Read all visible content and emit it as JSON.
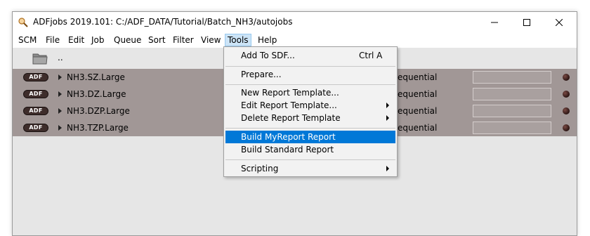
{
  "window": {
    "title": "ADFjobs 2019.101: C:/ADF_DATA/Tutorial/Batch_NH3/autojobs"
  },
  "menubar": {
    "items": [
      "SCM",
      "File",
      "Edit",
      "Job",
      "Queue",
      "Sort",
      "Filter",
      "View",
      "Tools",
      "Help"
    ],
    "active": "Tools"
  },
  "toolbar": {
    "parent_dir": ".."
  },
  "jobs": [
    {
      "badge": "ADF",
      "name": "NH3.SZ.Large",
      "mode": "equential"
    },
    {
      "badge": "ADF",
      "name": "NH3.DZ.Large",
      "mode": "equential"
    },
    {
      "badge": "ADF",
      "name": "NH3.DZP.Large",
      "mode": "equential"
    },
    {
      "badge": "ADF",
      "name": "NH3.TZP.Large",
      "mode": "equential"
    }
  ],
  "tools_menu": {
    "add_to_sdf": {
      "label": "Add To SDF...",
      "shortcut": "Ctrl A"
    },
    "prepare": {
      "label": "Prepare..."
    },
    "new_report_template": {
      "label": "New Report Template..."
    },
    "edit_report_template": {
      "label": "Edit Report Template..."
    },
    "delete_report_template": {
      "label": "Delete Report Template"
    },
    "build_myreport": {
      "label": "Build MyReport Report"
    },
    "build_standard": {
      "label": "Build Standard Report"
    },
    "scripting": {
      "label": "Scripting"
    }
  },
  "colors": {
    "menu_highlight": "#0078d7",
    "active_menu": "#cce4f7",
    "job_area": "#a19796",
    "window_bg": "#e6e6e6"
  },
  "icons": [
    "app-icon",
    "minimize-icon",
    "maximize-icon",
    "close-icon",
    "folder-icon",
    "expand-arrow-icon",
    "status-dot-icon",
    "submenu-arrow-icon"
  ]
}
